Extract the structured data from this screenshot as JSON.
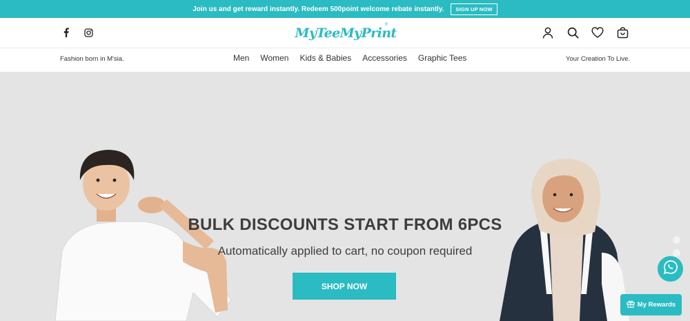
{
  "announcement": {
    "text": "Join us and get reward instantly. Redeem 500point welcome rebate instantly.",
    "button": "SIGN UP NOW"
  },
  "header": {
    "logo_text": "MyTeeMyPrint",
    "logo_mark": "®",
    "social_icons": [
      "facebook-icon",
      "instagram-icon"
    ],
    "tool_icons": [
      "user-icon",
      "search-icon",
      "heart-icon",
      "cart-icon"
    ]
  },
  "subnav": {
    "tagline_left": "Fashion born in M'sia.",
    "tagline_right": "Your Creation To Live.",
    "menu": [
      "Men",
      "Women",
      "Kids & Babies",
      "Accessories",
      "Graphic Tees"
    ]
  },
  "hero": {
    "title": "BULK DISCOUNTS START FROM 6PCS",
    "subtitle": "Automatically applied to cart, no coupon required",
    "button": "SHOP NOW"
  },
  "widgets": {
    "rewards_label": "My Rewards"
  },
  "colors": {
    "brand": "#2bbbc2",
    "hero_bg": "#e3e4e3"
  }
}
